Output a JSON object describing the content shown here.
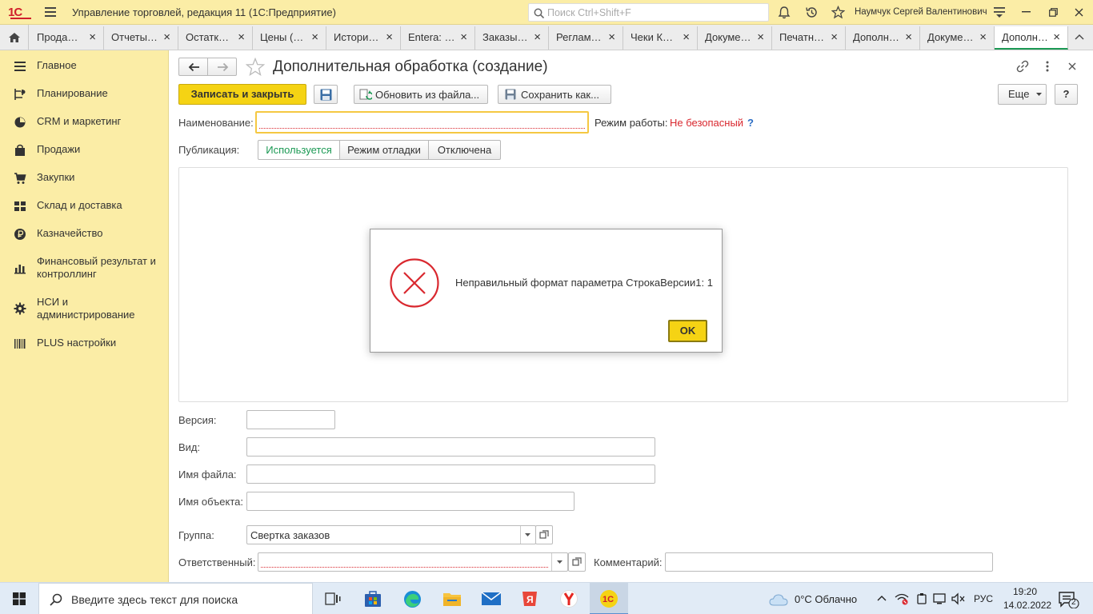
{
  "titlebar": {
    "logo": "1С",
    "app_title": "Управление торговлей, редакция 11  (1С:Предприятие)",
    "search_placeholder": "Поиск Ctrl+Shift+F",
    "user": "Наумчук Сергей Валентинович"
  },
  "tabs": [
    {
      "label": "Прода…"
    },
    {
      "label": "Отчеты…"
    },
    {
      "label": "Остатк…"
    },
    {
      "label": "Цены (…"
    },
    {
      "label": "Истори…"
    },
    {
      "label": "Entera: …"
    },
    {
      "label": "Заказы…"
    },
    {
      "label": "Реглам…"
    },
    {
      "label": "Чеки К…"
    },
    {
      "label": "Докуме…"
    },
    {
      "label": "Печатн…"
    },
    {
      "label": "Дополн…"
    },
    {
      "label": "Докуме…"
    },
    {
      "label": "Дополн…"
    }
  ],
  "sidebar": {
    "items": [
      {
        "label": "Главное",
        "icon": "menu-lines-icon"
      },
      {
        "label": "Планирование",
        "icon": "planning-icon"
      },
      {
        "label": "CRM и маркетинг",
        "icon": "crm-icon"
      },
      {
        "label": "Продажи",
        "icon": "bag-icon"
      },
      {
        "label": "Закупки",
        "icon": "cart-icon"
      },
      {
        "label": "Склад и доставка",
        "icon": "warehouse-icon"
      },
      {
        "label": "Казначейство",
        "icon": "ruble-icon"
      },
      {
        "label": "Финансовый результат и контроллинг",
        "icon": "bar-chart-icon"
      },
      {
        "label": "НСИ и администрирование",
        "icon": "gear-icon"
      },
      {
        "label": "PLUS настройки",
        "icon": "barcode-icon"
      }
    ]
  },
  "form": {
    "title": "Дополнительная обработка (создание)",
    "save_close": "Записать и закрыть",
    "update_from_file": "Обновить из файла...",
    "save_as": "Сохранить как...",
    "more": "Еще",
    "help": "?",
    "name_label": "Наименование:",
    "name_value": "",
    "mode_label": "Режим работы:",
    "mode_value": "Не безопасный",
    "mode_help": "?",
    "publication_label": "Публикация:",
    "publication_options": [
      "Используется",
      "Режим отладки",
      "Отключена"
    ],
    "version_label": "Версия:",
    "kind_label": "Вид:",
    "filename_label": "Имя файла:",
    "object_label": "Имя объекта:",
    "group_label": "Группа:",
    "group_value": "Свертка заказов",
    "responsible_label": "Ответственный:",
    "comment_label": "Комментарий:"
  },
  "dialog": {
    "message": "Неправильный формат параметра СтрокаВерсии1: 1",
    "ok": "OK"
  },
  "taskbar": {
    "search_placeholder": "Введите здесь текст для поиска",
    "weather": "0°C  Облачно",
    "lang": "РУС",
    "time": "19:20",
    "date": "14.02.2022",
    "notifications": "2"
  },
  "colors": {
    "titlebar_bg": "#fbeda6",
    "primary_button": "#f5d314",
    "active_tab_accent": "#1b9954",
    "error_red": "#d9282f",
    "unsafe_text": "#d9282f"
  }
}
